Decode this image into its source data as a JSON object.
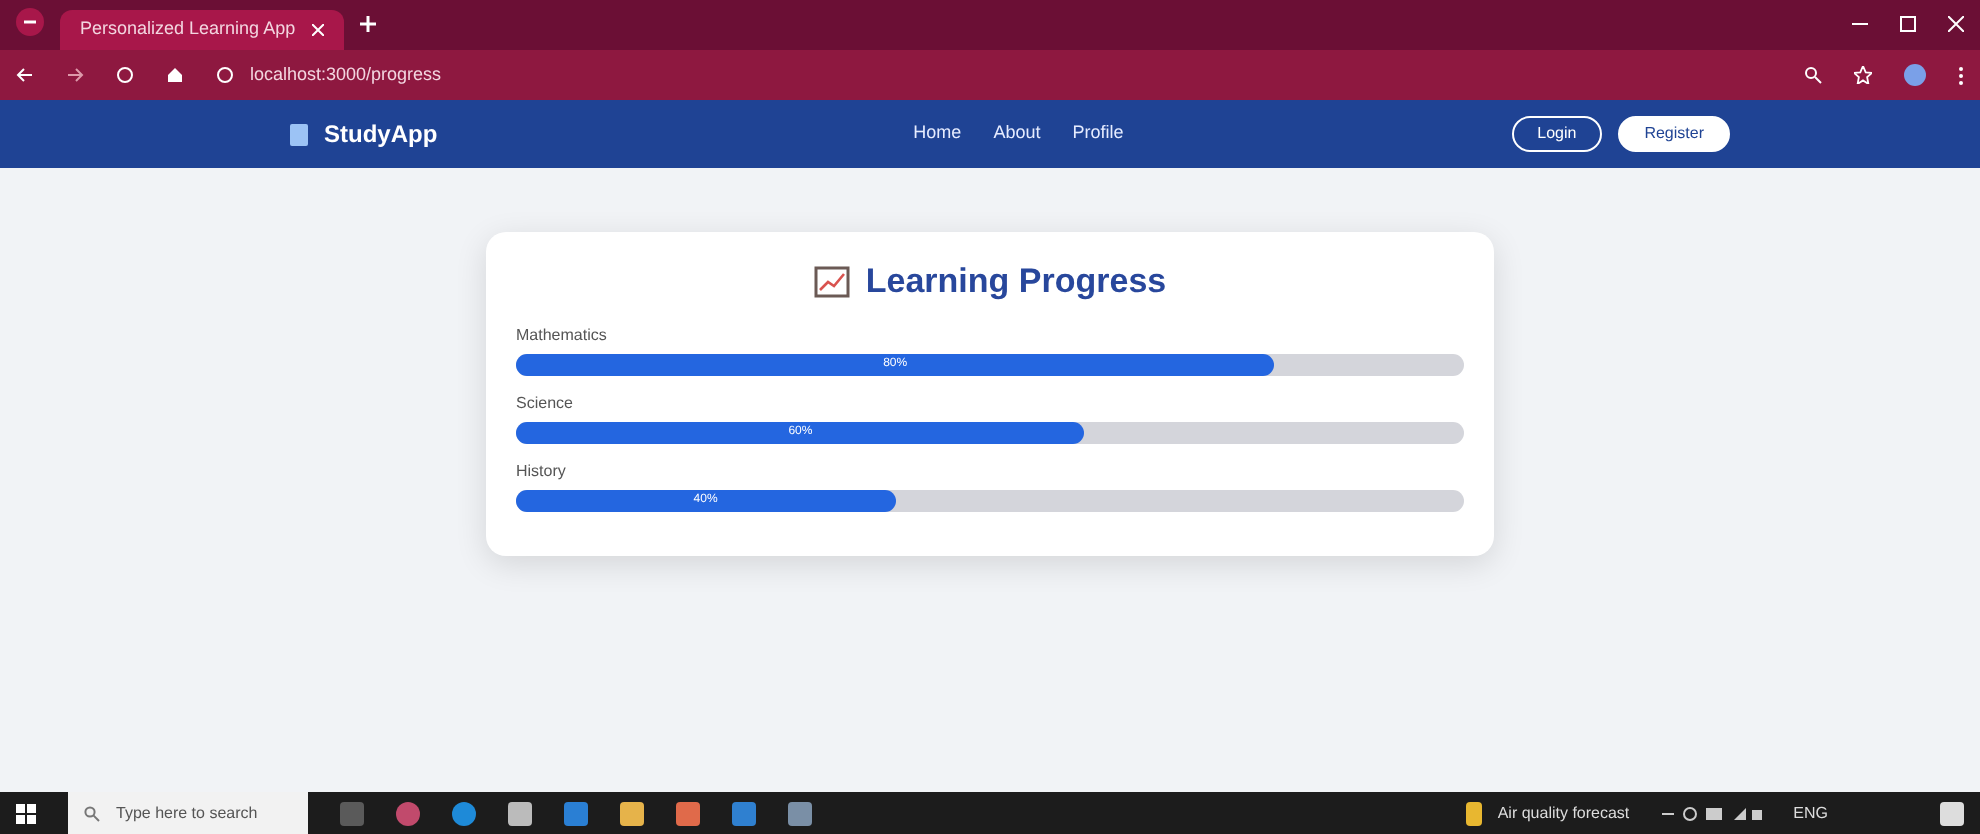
{
  "browser": {
    "tab_title": "Personalized Learning App",
    "url": "localhost:3000/progress"
  },
  "navbar": {
    "brand": "StudyApp",
    "links": [
      "Home",
      "About",
      "Profile"
    ],
    "buttons": [
      {
        "label": "Login",
        "kind": "outline"
      },
      {
        "label": "Register",
        "kind": "solid"
      }
    ]
  },
  "card": {
    "title": "Learning Progress",
    "subjects": [
      {
        "name": "Mathematics",
        "level": 0.8,
        "reading": "80%"
      },
      {
        "name": "Science",
        "level": 0.6,
        "reading": "60%"
      },
      {
        "name": "History",
        "level": 0.4,
        "reading": "40%"
      }
    ]
  },
  "taskbar": {
    "search_placeholder": "Type here to search",
    "weather": "Air quality forecast",
    "language": "ENG"
  }
}
